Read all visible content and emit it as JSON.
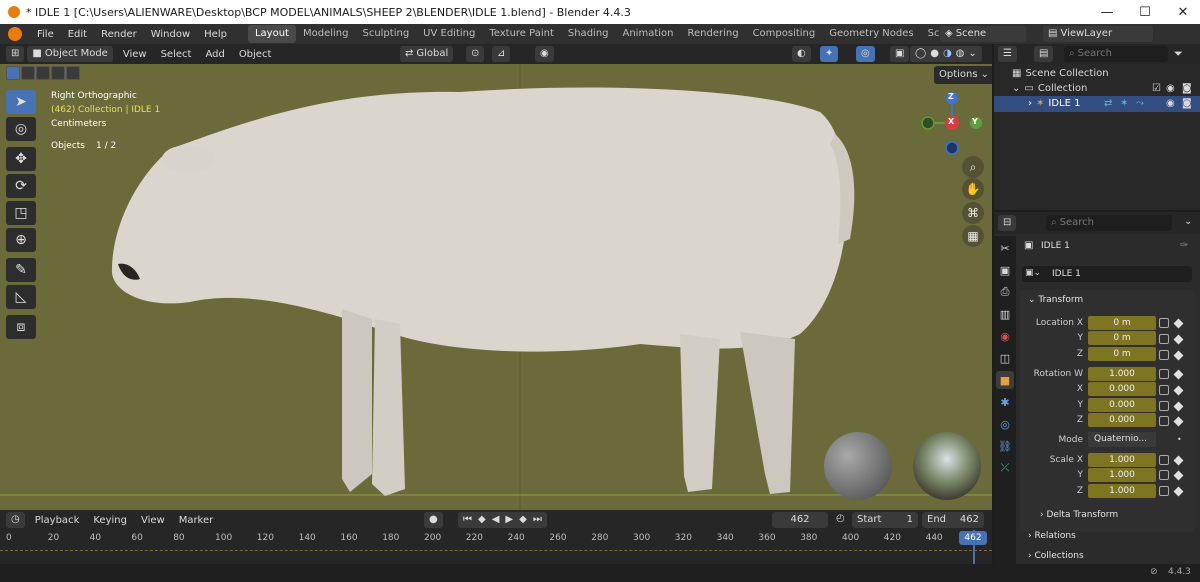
{
  "window": {
    "title": "* IDLE 1 [C:\\Users\\ALIENWARE\\Desktop\\BCP MODEL\\ANIMALS\\SHEEP 2\\BLENDER\\IDLE 1.blend] - Blender 4.4.3",
    "minimize": "—",
    "maximize": "☐",
    "close": "✕"
  },
  "menus": [
    "File",
    "Edit",
    "Render",
    "Window",
    "Help"
  ],
  "workspaces": [
    "Layout",
    "Modeling",
    "Sculpting",
    "UV Editing",
    "Texture Paint",
    "Shading",
    "Animation",
    "Rendering",
    "Compositing",
    "Geometry Nodes",
    "Scripting"
  ],
  "workspace_add": "+",
  "scene": {
    "scene_label": "Scene",
    "view_layer_label": "ViewLayer"
  },
  "viewport_header": {
    "mode": "Object Mode",
    "items": [
      "View",
      "Select",
      "Add",
      "Object"
    ],
    "orientation": "Global",
    "options": "Options"
  },
  "viewport_overlay": {
    "view_name": "Right Orthographic",
    "collection": "(462) Collection | IDLE 1",
    "units": "Centimeters",
    "objects_label": "Objects",
    "objects_count": "1 / 2"
  },
  "gizmo": {
    "z": "Z",
    "x": "X",
    "y": "Y"
  },
  "timeline": {
    "menus": [
      "Playback",
      "Keying",
      "View",
      "Marker"
    ],
    "current_frame": "462",
    "start_label": "Start",
    "start": "1",
    "end_label": "End",
    "end": "462",
    "ticks": [
      "0",
      "20",
      "40",
      "60",
      "80",
      "100",
      "120",
      "140",
      "160",
      "180",
      "200",
      "220",
      "240",
      "260",
      "280",
      "300",
      "320",
      "340",
      "360",
      "380",
      "400",
      "420",
      "440"
    ],
    "playhead": "462"
  },
  "status": {
    "version": "4.4.3"
  },
  "outliner": {
    "search_placeholder": "Search",
    "scene_collection": "Scene Collection",
    "collection": "Collection",
    "object": "IDLE 1"
  },
  "properties": {
    "search_placeholder": "Search",
    "object_name": "IDLE 1",
    "data_name": "IDLE 1",
    "transform_label": "Transform",
    "location_x_label": "Location X",
    "y_label": "Y",
    "z_label": "Z",
    "location": [
      "0 m",
      "0 m",
      "0 m"
    ],
    "rotation_w_label": "Rotation W",
    "x_label": "X",
    "rotation": [
      "1.000",
      "0.000",
      "0.000",
      "0.000"
    ],
    "mode_label": "Mode",
    "mode_value": "Quaternio...",
    "scale_x_label": "Scale X",
    "scale": [
      "1.000",
      "1.000",
      "1.000"
    ],
    "delta_transform": "Delta Transform",
    "relations": "Relations",
    "collections": "Collections"
  }
}
